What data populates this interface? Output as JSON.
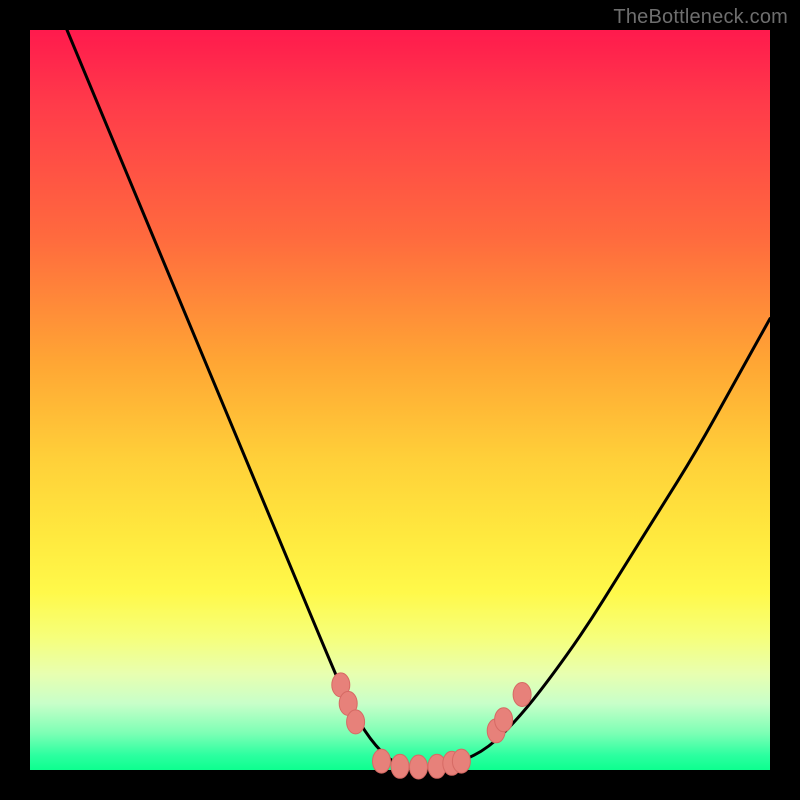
{
  "watermark": "TheBottleneck.com",
  "colors": {
    "frame": "#000000",
    "gradient_top": "#ff1a4d",
    "gradient_mid1": "#ffa634",
    "gradient_mid2": "#ffe83e",
    "gradient_bottom": "#0dff8f",
    "curve": "#000000",
    "marker_fill": "#e7817a",
    "marker_stroke": "#d66a64"
  },
  "chart_data": {
    "type": "line",
    "title": "",
    "xlabel": "",
    "ylabel": "",
    "xlim": [
      0,
      100
    ],
    "ylim": [
      0,
      100
    ],
    "series": [
      {
        "name": "bottleneck-curve",
        "x": [
          5,
          10,
          15,
          20,
          25,
          30,
          35,
          40,
          43,
          46,
          49,
          52,
          55,
          58,
          62,
          66,
          70,
          75,
          80,
          85,
          90,
          95,
          100
        ],
        "y": [
          100,
          88,
          76,
          64,
          52,
          40,
          28,
          16,
          9,
          4,
          1,
          0,
          0,
          1,
          3,
          7,
          12,
          19,
          27,
          35,
          43,
          52,
          61
        ]
      }
    ],
    "markers": [
      {
        "x": 42.0,
        "y": 11.5
      },
      {
        "x": 43.0,
        "y": 9.0
      },
      {
        "x": 44.0,
        "y": 6.5
      },
      {
        "x": 47.5,
        "y": 1.2
      },
      {
        "x": 50.0,
        "y": 0.5
      },
      {
        "x": 52.5,
        "y": 0.4
      },
      {
        "x": 55.0,
        "y": 0.5
      },
      {
        "x": 57.0,
        "y": 0.9
      },
      {
        "x": 58.3,
        "y": 1.2
      },
      {
        "x": 63.0,
        "y": 5.3
      },
      {
        "x": 64.0,
        "y": 6.8
      },
      {
        "x": 66.5,
        "y": 10.2
      }
    ]
  }
}
